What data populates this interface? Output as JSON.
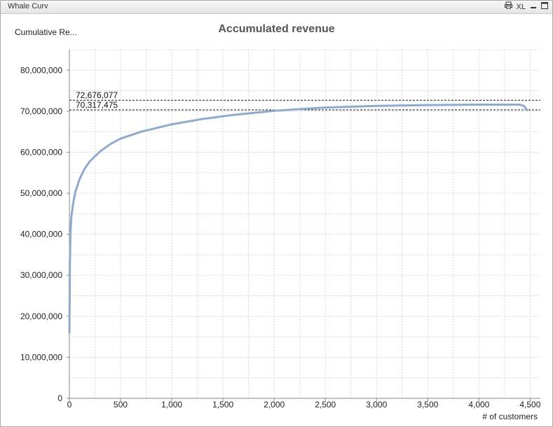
{
  "window": {
    "title": "Whale Curv",
    "icons": [
      "print-icon",
      "xl-export-icon",
      "minimize-icon",
      "maximize-icon"
    ],
    "xl_label": "XL"
  },
  "expression_label": "Cumulative Re...",
  "chart_data": {
    "type": "line",
    "title": "Accumulated revenue",
    "xlabel": "# of customers",
    "ylabel": "",
    "xlim": [
      0,
      4600
    ],
    "ylim": [
      0,
      85000000
    ],
    "x_ticks": [
      0,
      500,
      1000,
      1500,
      2000,
      2500,
      3000,
      3500,
      4000,
      4500
    ],
    "x_tick_labels": [
      "0",
      "500",
      "1,000",
      "1,500",
      "2,000",
      "2,500",
      "3,000",
      "3,500",
      "4,000",
      "4,500"
    ],
    "y_ticks": [
      0,
      10000000,
      20000000,
      30000000,
      40000000,
      50000000,
      60000000,
      70000000,
      80000000
    ],
    "y_tick_labels": [
      "0",
      "10,000,000",
      "20,000,000",
      "30,000,000",
      "40,000,000",
      "50,000,000",
      "60,000,000",
      "70,000,000",
      "80,000,000"
    ],
    "grid": true,
    "line_color": "#8faacc",
    "reference_lines": [
      {
        "value": 72676077,
        "label": "72,676,077"
      },
      {
        "value": 70317475,
        "label": "70,317,475"
      }
    ],
    "series": [
      {
        "x": [
          1,
          5,
          10,
          20,
          40,
          60,
          100,
          150,
          200,
          300,
          400,
          500,
          700,
          1000,
          1300,
          1600,
          2000,
          2500,
          3000,
          3500,
          4000,
          4400,
          4440,
          4470
        ],
        "values": [
          16000000,
          33000000,
          40000000,
          44500000,
          48000000,
          50500000,
          53500000,
          56000000,
          57800000,
          60200000,
          62000000,
          63300000,
          65000000,
          66800000,
          68100000,
          69100000,
          70100000,
          70900000,
          71300000,
          71500000,
          71600000,
          71600000,
          71300000,
          70300000
        ]
      }
    ]
  }
}
